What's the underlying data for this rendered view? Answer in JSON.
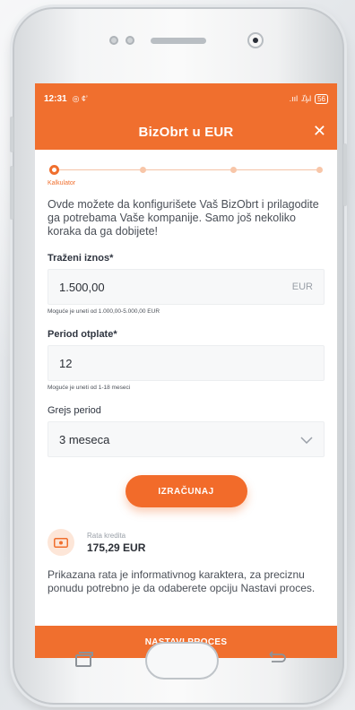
{
  "status_bar": {
    "time": "12:31",
    "left_icons": "◎ ¢’",
    "signal": ".ııl",
    "signal2": "₯l",
    "battery": "56"
  },
  "app_bar": {
    "title": "BizObrt u EUR",
    "close": "✕"
  },
  "stepper": {
    "active_step_label": "Kalkulator",
    "steps": 4,
    "active_index": 0
  },
  "intro_text": "Ovde možete da konfigurišete Vaš BizObrt i prilagodite ga potrebama Vaše kompanije. Samo još nekoliko koraka da ga dobijete!",
  "form": {
    "amount": {
      "label": "Traženi iznos*",
      "value": "1.500,00",
      "currency": "EUR",
      "hint": "Moguće je uneti od 1.000,00-5.000,00 EUR"
    },
    "period": {
      "label": "Period otplate*",
      "value": "12",
      "hint": "Moguće je uneti od 1-18 meseci"
    },
    "grace": {
      "label": "Grejs period",
      "value": "3 meseca"
    }
  },
  "calc_button": "IZRAČUNAJ",
  "result": {
    "label": "Rata kredita",
    "amount": "175,29 EUR"
  },
  "note": "Prikazana rata je informativnog karaktera, za preciznu ponudu potrebno je da odaberete opciju Nastavi proces.",
  "continue_button": "NASTAVI PROCES",
  "colors": {
    "accent": "#f06f2e",
    "accent_light": "#fde6d8"
  }
}
